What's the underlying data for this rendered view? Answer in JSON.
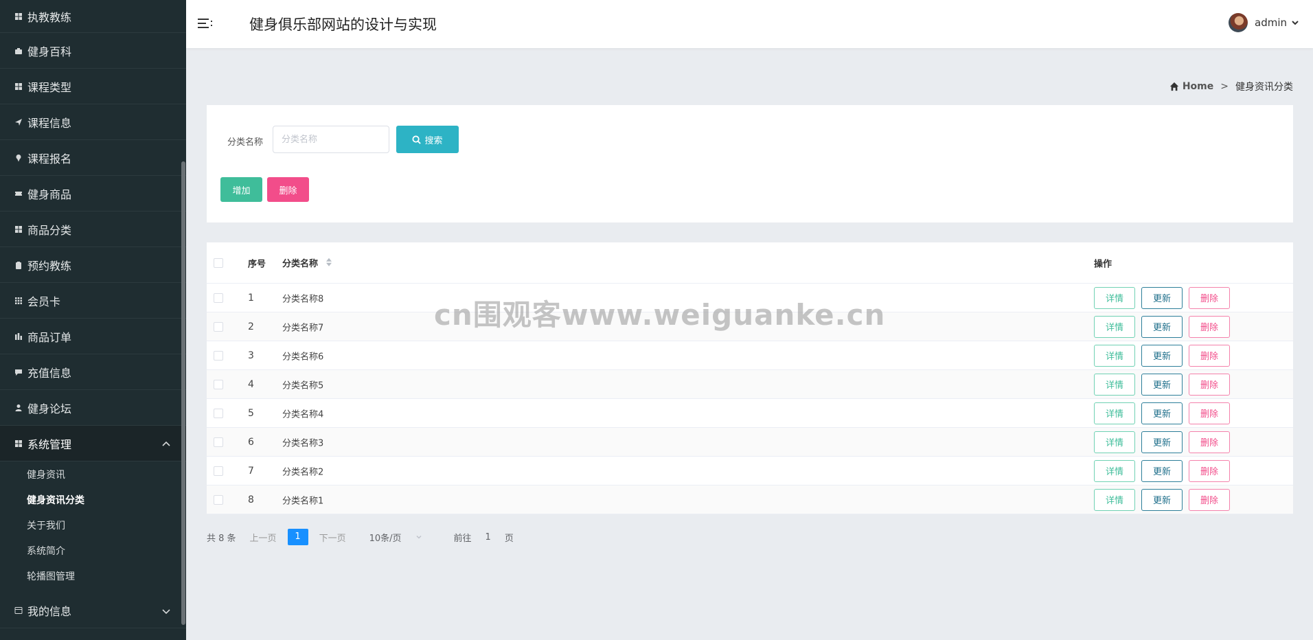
{
  "header": {
    "site_title": "健身俱乐部网站的设计与实现",
    "user_name": "admin"
  },
  "sidebar": {
    "items": [
      {
        "label": "执教教练",
        "icon": "grid-icon"
      },
      {
        "label": "健身百科",
        "icon": "briefcase-icon"
      },
      {
        "label": "课程类型",
        "icon": "grid-icon"
      },
      {
        "label": "课程信息",
        "icon": "send-icon"
      },
      {
        "label": "课程报名",
        "icon": "pin-icon"
      },
      {
        "label": "健身商品",
        "icon": "ticket-icon"
      },
      {
        "label": "商品分类",
        "icon": "grid-icon"
      },
      {
        "label": "预约教练",
        "icon": "clipboard-icon"
      },
      {
        "label": "会员卡",
        "icon": "apps-icon"
      },
      {
        "label": "商品订单",
        "icon": "chart-icon"
      },
      {
        "label": "充值信息",
        "icon": "chat-icon"
      },
      {
        "label": "健身论坛",
        "icon": "user-icon"
      }
    ],
    "system": {
      "label": "系统管理",
      "sub_items": [
        "健身资讯",
        "健身资讯分类",
        "关于我们",
        "系统简介",
        "轮播图管理"
      ],
      "active_sub": "健身资讯分类"
    },
    "my_info": {
      "label": "我的信息"
    }
  },
  "breadcrumb": {
    "home": "Home",
    "separator": ">",
    "current": "健身资讯分类"
  },
  "search": {
    "label": "分类名称",
    "placeholder": "分类名称",
    "button": "搜索"
  },
  "toolbar": {
    "add_label": "增加",
    "delete_label": "删除"
  },
  "table": {
    "headers": {
      "index": "序号",
      "name": "分类名称",
      "ops": "操作"
    },
    "rows": [
      {
        "index": "1",
        "name": "分类名称8"
      },
      {
        "index": "2",
        "name": "分类名称7"
      },
      {
        "index": "3",
        "name": "分类名称6"
      },
      {
        "index": "4",
        "name": "分类名称5"
      },
      {
        "index": "5",
        "name": "分类名称4"
      },
      {
        "index": "6",
        "name": "分类名称3"
      },
      {
        "index": "7",
        "name": "分类名称2"
      },
      {
        "index": "8",
        "name": "分类名称1"
      }
    ],
    "actions": {
      "detail": "详情",
      "update": "更新",
      "remove": "删除"
    }
  },
  "pager": {
    "total": "共 8 条",
    "prev": "上一页",
    "current_page": "1",
    "next": "下一页",
    "page_size": "10条/页",
    "goto_prefix": "前往",
    "goto_value": "1",
    "goto_suffix": "页"
  },
  "watermark": "cn围观客www.weiguanke.cn"
}
